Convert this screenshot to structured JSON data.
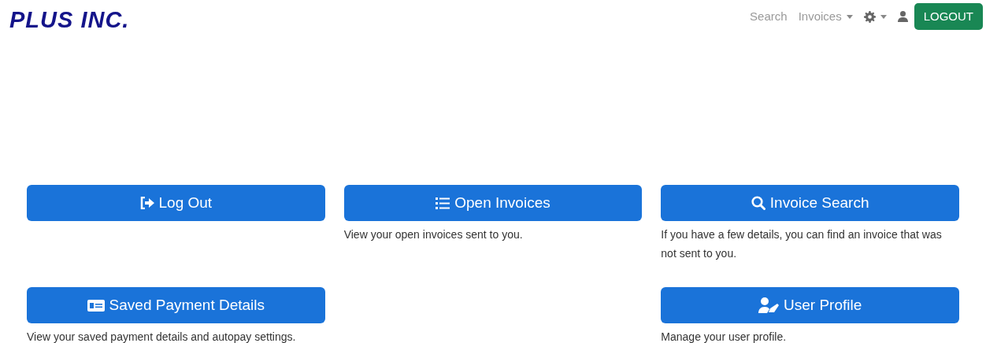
{
  "logo": "PLUS INC.",
  "nav": [
    {
      "kind": "link",
      "label": "Search"
    },
    {
      "kind": "dropdown",
      "label": "Invoices"
    },
    {
      "kind": "gear-dropdown"
    },
    {
      "kind": "user"
    },
    {
      "kind": "button",
      "label": "LOGOUT"
    }
  ],
  "tile_rows": [
    [
      {
        "kind": "logout",
        "label": "Log Out"
      },
      {
        "kind": "list",
        "label": "Open Invoices",
        "description": "View your open invoices sent to you."
      },
      {
        "kind": "search",
        "label": "Invoice Search",
        "description": "If you have a few details, you can find an invoice that was not sent to you."
      }
    ],
    [
      {
        "kind": "card",
        "label": "Saved Payment Details",
        "description": "View your saved payment details and autopay settings."
      },
      {
        "kind": "blank"
      },
      {
        "kind": "user",
        "label": "User Profile",
        "description": "Manage your user profile."
      }
    ]
  ]
}
